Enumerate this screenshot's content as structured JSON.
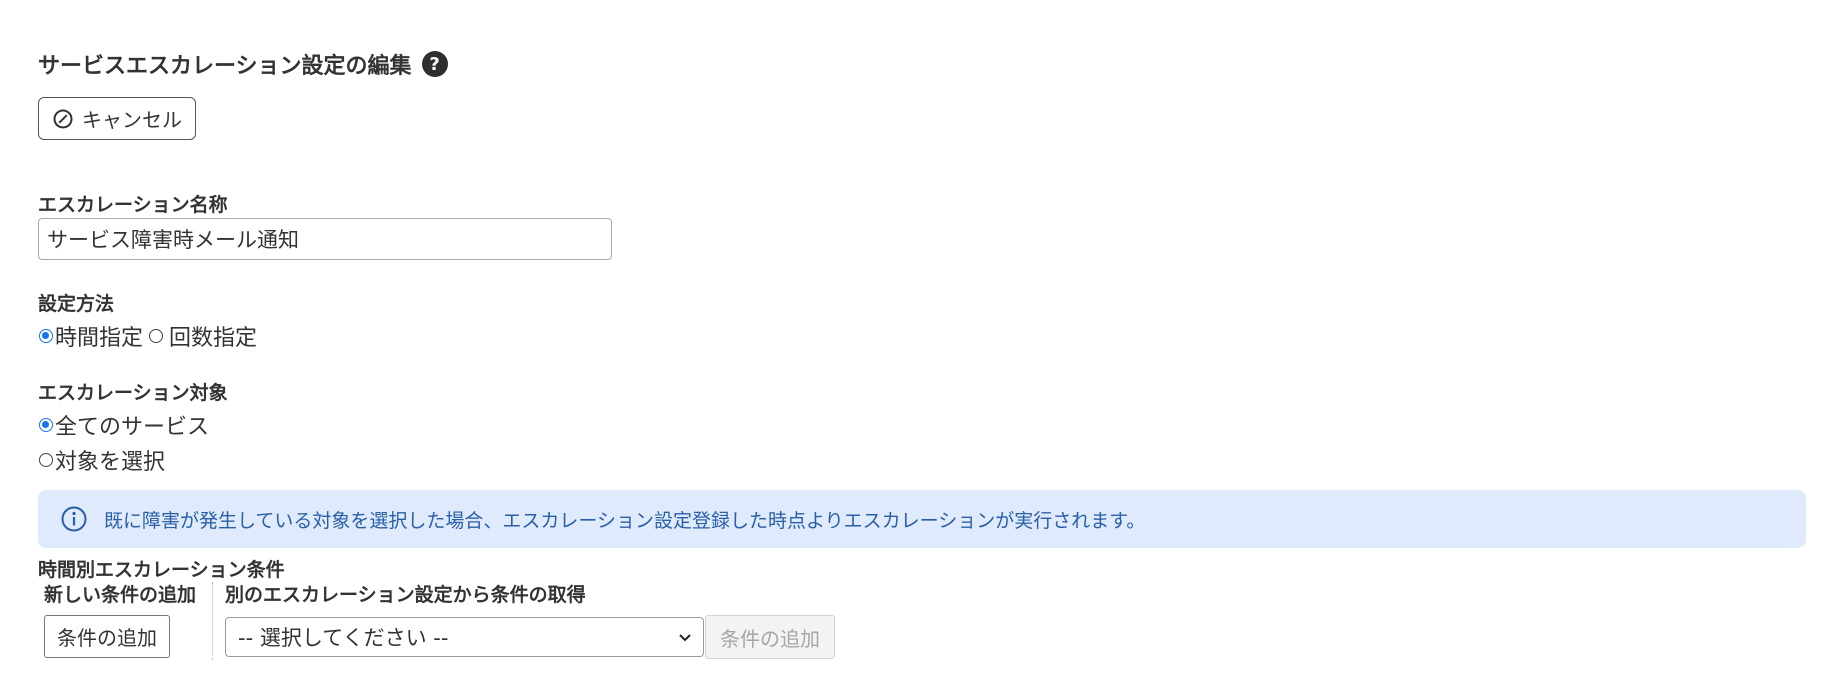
{
  "header": {
    "title": "サービスエスカレーション設定の編集",
    "help_icon_glyph": "?",
    "help_icon": "question-circle-icon"
  },
  "toolbar": {
    "cancel_label": "キャンセル",
    "cancel_icon": "cancel-circle-icon"
  },
  "form": {
    "name_label": "エスカレーション名称",
    "name_value": "サービス障害時メール通知",
    "method_label": "設定方法",
    "method_options": [
      {
        "label": "時間指定",
        "checked": true
      },
      {
        "label": "回数指定",
        "checked": false
      }
    ],
    "target_label": "エスカレーション対象",
    "target_options": [
      {
        "label": "全てのサービス",
        "checked": true
      },
      {
        "label": "対象を選択",
        "checked": false
      }
    ]
  },
  "info": {
    "icon": "info-circle-icon",
    "message": "既に障害が発生している対象を選択した場合、エスカレーション設定登録した時点よりエスカレーションが実行されます。"
  },
  "conditions": {
    "section_label": "時間別エスカレーション条件",
    "new_label": "新しい条件の追加",
    "add_button_label": "条件の追加",
    "copy_label": "別のエスカレーション設定から条件の取得",
    "select_value": "-- 選択してください --",
    "copy_add_button_label": "条件の追加"
  },
  "colors": {
    "accent": "#1a73e8",
    "info_bg": "#dfeafc",
    "info_text": "#2a5fa8"
  }
}
